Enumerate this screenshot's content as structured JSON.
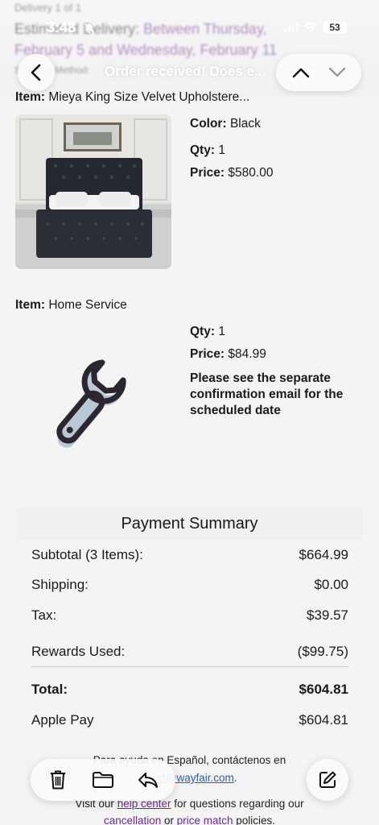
{
  "status_bar": {
    "time": "3:48",
    "battery": "53"
  },
  "header_blur": {
    "line1": "Delivery 1 of 1",
    "line2_prefix": "Estimated Delivery: ",
    "line2_highlight": "Between Thursday,",
    "line3": "February 5 and Wednesday, February 11",
    "line4": "Shipping Method: "
  },
  "top_bar": {
    "title": "Order received! Does e..."
  },
  "items": [
    {
      "label": "Item:",
      "name": "Mieya King Size Velvet Upholstere...",
      "color_label": "Color:",
      "color": "Black",
      "qty_label": "Qty:",
      "qty": "1",
      "price_label": "Price:",
      "price": "$580.00"
    },
    {
      "label": "Item:",
      "name": "Home Service",
      "qty_label": "Qty:",
      "qty": "1",
      "price_label": "Price:",
      "price": "$84.99",
      "note": "Please see the separate confirmation email for the scheduled date"
    }
  ],
  "payment_summary": {
    "title": "Payment Summary",
    "subtotal_label": "Subtotal (3 Items):",
    "subtotal": "$664.99",
    "shipping_label": "Shipping:",
    "shipping": "$0.00",
    "tax_label": "Tax:",
    "tax": "$39.57",
    "rewards_label": "Rewards Used:",
    "rewards": "($99.75)",
    "total_label": "Total:",
    "total": "$604.81",
    "method_label": "Apple Pay",
    "method_amount": "$604.81"
  },
  "footer": {
    "spanish_prefix": "Para ayuda en Español, contáctenos en",
    "email_visible": "ort@wayfair.com",
    "email_suffix": ".",
    "help_prefix": "Visit our ",
    "help_link": "help center",
    "help_suffix": " for questions regarding our",
    "policy_link1": "cancellation",
    "policy_mid": " or ",
    "policy_link2": "price match",
    "policy_suffix": " policies."
  },
  "colors": {
    "purple_link": "#6b2c91",
    "wrench_dark": "#2b2630",
    "wrench_light": "#b8c8d4"
  }
}
